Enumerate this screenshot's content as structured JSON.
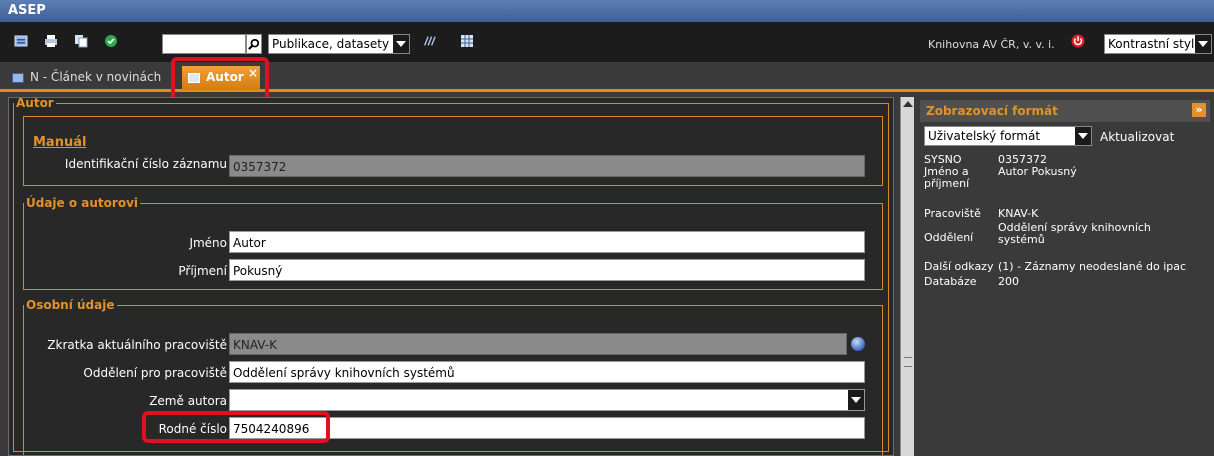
{
  "app": {
    "title": "ASEP"
  },
  "toolbar": {
    "search_value": "",
    "db_select": "Publikace, datasety",
    "library": "Knihovna AV ČR, v. v. i.",
    "style_select": "Kontrastní styl"
  },
  "tabs": [
    {
      "label": "N - Článek v novinách",
      "active": false
    },
    {
      "label": "Autor",
      "active": true
    }
  ],
  "form": {
    "autor_legend": "Autor",
    "manual_label": "Manuál",
    "id_label": "Identifikační číslo záznamu",
    "id_value": "0357372",
    "udaje_legend": "Údaje o autorovi",
    "jmeno_label": "Jméno",
    "jmeno_value": "Autor",
    "prijmeni_label": "Příjmení",
    "prijmeni_value": "Pokusný",
    "osobni_legend": "Osobní údaje",
    "zkratka_label": "Zkratka aktuálního pracoviště",
    "zkratka_value": "KNAV-K",
    "oddeleni_label": "Oddělení pro pracoviště",
    "oddeleni_value": "Oddělení správy knihovních systémů",
    "zeme_label": "Země autora",
    "zeme_value": "",
    "rodne_label": "Rodné číslo",
    "rodne_value": "7504240896"
  },
  "right_panel": {
    "title": "Zobrazovací formát",
    "format_select": "Uživatelský formát",
    "update_label": "Aktualizovat",
    "rows": [
      {
        "key": "SYSNO",
        "value": "0357372"
      },
      {
        "key": "Jméno a příjmení",
        "value": "Autor Pokusný"
      },
      {
        "key": "Pracoviště",
        "value": "KNAV-K"
      },
      {
        "key": "Oddělení",
        "value": "Oddělení správy knihovních systémů"
      },
      {
        "key": "Další odkazy",
        "value": "(1) - Záznamy neodeslané do ipac"
      },
      {
        "key": "Databáze",
        "value": "200"
      }
    ]
  },
  "colors": {
    "accent": "#e2912a",
    "highlight": "#e01020",
    "title_bar": "#4a6ea6"
  }
}
